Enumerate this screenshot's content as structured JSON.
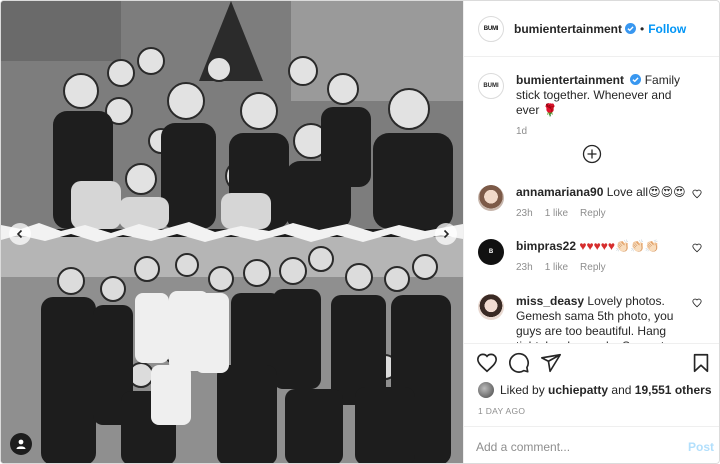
{
  "header": {
    "username": "bumientertainment",
    "separator": "•",
    "follow_label": "Follow",
    "logo_text": "BUMI"
  },
  "caption": {
    "username": "bumientertainment",
    "text": "Family stick together. Whenever and ever 🌹",
    "age": "1d"
  },
  "comments": [
    {
      "username": "annamariana90",
      "text": "Love all😍😍😍",
      "age": "23h",
      "likes": "1 like",
      "reply": "Reply"
    },
    {
      "username": "bimpras22",
      "text": "♥♥♥♥♥👏🏻👏🏻👏🏻",
      "age": "23h",
      "likes": "1 like",
      "reply": "Reply"
    },
    {
      "username": "miss_deasy",
      "text": "Lovely photos. Gemesh sama 5th photo, you guys are too beautiful. Hang tight, lovely people. Support each",
      "age": "",
      "likes": "",
      "reply": ""
    }
  ],
  "likes": {
    "prefix": "Liked by",
    "user": "uchiepatty",
    "and": "and",
    "count": "19,551 others"
  },
  "date": "1 DAY AGO",
  "add_comment": {
    "placeholder": "Add a comment...",
    "post_label": "Post"
  },
  "colors": {
    "follow": "#0095f6",
    "post_disabled": "#b2dffc",
    "verified": "#3897f0",
    "meta": "#8e8e8e"
  },
  "icons": [
    "chevron-left-icon",
    "chevron-right-icon",
    "user-tag-icon",
    "verified-icon",
    "plus-circle-icon",
    "heart-icon",
    "comment-icon",
    "share-icon",
    "bookmark-icon"
  ]
}
